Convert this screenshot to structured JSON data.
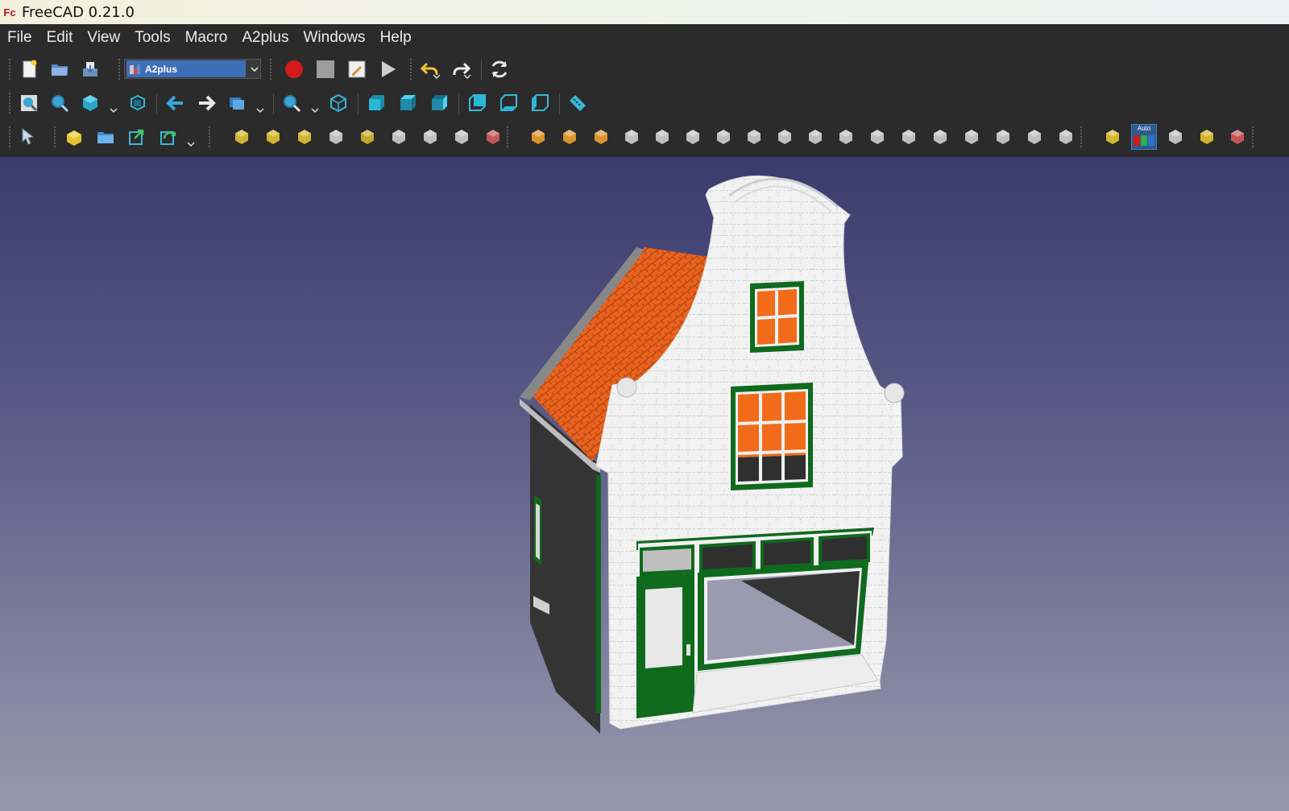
{
  "window": {
    "title": "FreeCAD 0.21.0",
    "logo_text": "Fc"
  },
  "menu": {
    "items": [
      {
        "label": "File"
      },
      {
        "label": "Edit"
      },
      {
        "label": "View"
      },
      {
        "label": "Tools"
      },
      {
        "label": "Macro"
      },
      {
        "label": "A2plus"
      },
      {
        "label": "Windows"
      },
      {
        "label": "Help"
      }
    ]
  },
  "toolbar": {
    "workbench_selected": "A2plus",
    "auto_label": "Auto"
  },
  "colors": {
    "background_top": "#3a3b6d",
    "background_bottom": "#9898ad",
    "toolbar_bg": "#2b2b2b",
    "roof": "#e8621e",
    "window_frame": "#0f6a1e",
    "wall": "#f2f2f2",
    "side_wall": "#343434"
  },
  "icons": [
    "new-document-icon",
    "open-file-icon",
    "save-icon",
    "workbench-selector",
    "record-macro-icon",
    "stop-macro-icon",
    "edit-macro-icon",
    "run-macro-icon",
    "undo-icon",
    "redo-icon",
    "refresh-icon",
    "fit-all-icon",
    "fit-selection-icon",
    "draw-style-icon",
    "bounding-box-icon",
    "back-icon",
    "forward-icon",
    "sync-view-icon",
    "zoom-icon",
    "isometric-view-icon",
    "front-view-icon",
    "top-view-icon",
    "right-view-icon",
    "rear-view-icon",
    "bottom-view-icon",
    "left-view-icon",
    "measure-icon"
  ]
}
